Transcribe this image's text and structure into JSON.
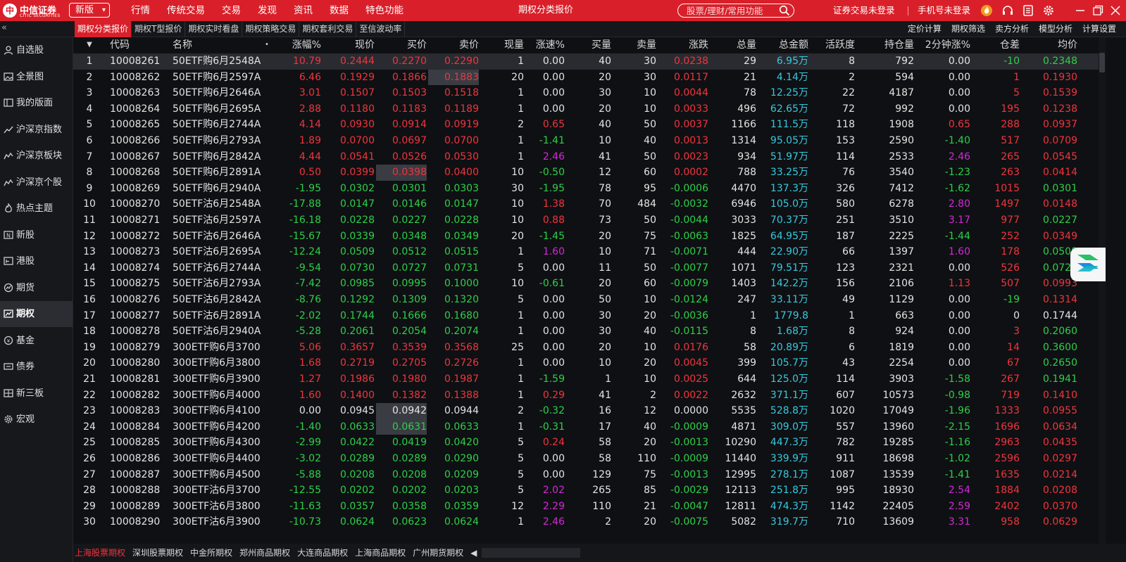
{
  "topbar": {
    "logo_cn": "中信证券",
    "logo_en": "CITIC SECURITIES",
    "version_label": "新版",
    "menu": [
      "行情",
      "传统交易",
      "交易",
      "发现",
      "资讯",
      "数据",
      "特色功能"
    ],
    "window_title": "期权分类报价",
    "search_placeholder": "股票/理财/常用功能",
    "trade_login": "证券交易未登录",
    "phone_login": "手机号未登录"
  },
  "subtabs": [
    "期权分类报价",
    "期权T型报价",
    "期权实时看盘",
    "期权策略交易",
    "期权套利交易",
    "至信波动率"
  ],
  "tools": [
    "定价计算",
    "期权筛选",
    "卖方分析",
    "模型分析",
    "计算设置"
  ],
  "sidebar": {
    "items": [
      {
        "label": "自选股",
        "icon": "user-icon"
      },
      {
        "label": "全景图",
        "icon": "image-icon"
      },
      {
        "label": "我的版面",
        "icon": "layout-icon"
      },
      {
        "label": "沪深京指数",
        "icon": "line-chart-icon"
      },
      {
        "label": "沪深京板块",
        "icon": "trend-icon"
      },
      {
        "label": "沪深京个股",
        "icon": "trend-icon"
      },
      {
        "label": "热点主题",
        "icon": "flame-icon"
      },
      {
        "label": "新股",
        "icon": "new-icon"
      },
      {
        "label": "港股",
        "icon": "hk-icon"
      },
      {
        "label": "期货",
        "icon": "gauge-icon"
      },
      {
        "label": "期权",
        "icon": "option-chart-icon"
      },
      {
        "label": "基金",
        "icon": "yen-icon"
      },
      {
        "label": "债券",
        "icon": "ticket-icon"
      },
      {
        "label": "新三板",
        "icon": "board-icon"
      },
      {
        "label": "宏观",
        "icon": "gear-icon"
      }
    ],
    "active_index": 10
  },
  "table": {
    "sort_mark": "▼",
    "name_mark": "•",
    "columns": [
      "",
      "代码",
      "名称",
      "涨幅%",
      "现价",
      "买价",
      "卖价",
      "现量",
      "涨速%",
      "买量",
      "卖量",
      "涨跌",
      "总量",
      "总金额",
      "活跃度",
      "持仓量",
      "2分钟涨%",
      "仓差",
      "均价"
    ],
    "rows": [
      [
        "1",
        "10008261",
        "50ETF购6月2548A",
        "10.79",
        "0.2444",
        "0.2270",
        "0.2290",
        "1",
        "0.00",
        "40",
        "30",
        "0.0238",
        "29",
        "6.95万",
        "8",
        "792",
        "0.00",
        "-10",
        "0.2348"
      ],
      [
        "2",
        "10008262",
        "50ETF购6月2597A",
        "6.46",
        "0.1929",
        "0.1866",
        "0.1883",
        "20",
        "0.00",
        "20",
        "30",
        "0.0117",
        "21",
        "4.14万",
        "2",
        "594",
        "0.00",
        "1",
        "0.1930"
      ],
      [
        "3",
        "10008263",
        "50ETF购6月2646A",
        "3.01",
        "0.1507",
        "0.1503",
        "0.1518",
        "1",
        "0.00",
        "30",
        "10",
        "0.0044",
        "78",
        "12.25万",
        "22",
        "4187",
        "0.00",
        "5",
        "0.1539"
      ],
      [
        "4",
        "10008264",
        "50ETF购6月2695A",
        "2.88",
        "0.1180",
        "0.1183",
        "0.1189",
        "1",
        "0.00",
        "20",
        "10",
        "0.0033",
        "496",
        "62.65万",
        "72",
        "992",
        "0.00",
        "195",
        "0.1238"
      ],
      [
        "5",
        "10008265",
        "50ETF购6月2744A",
        "4.14",
        "0.0930",
        "0.0914",
        "0.0919",
        "2",
        "0.65",
        "40",
        "50",
        "0.0037",
        "1166",
        "111.5万",
        "118",
        "1908",
        "0.65",
        "288",
        "0.0937"
      ],
      [
        "6",
        "10008266",
        "50ETF购6月2793A",
        "1.89",
        "0.0700",
        "0.0697",
        "0.0700",
        "1",
        "-1.41",
        "10",
        "40",
        "0.0013",
        "1314",
        "95.05万",
        "153",
        "2590",
        "-1.40",
        "517",
        "0.0709"
      ],
      [
        "7",
        "10008267",
        "50ETF购6月2842A",
        "4.44",
        "0.0541",
        "0.0526",
        "0.0530",
        "1",
        "2.46",
        "41",
        "50",
        "0.0023",
        "934",
        "51.97万",
        "114",
        "2533",
        "2.46",
        "265",
        "0.0545"
      ],
      [
        "8",
        "10008268",
        "50ETF购6月2891A",
        "0.50",
        "0.0399",
        "0.0398",
        "0.0400",
        "10",
        "-0.50",
        "12",
        "60",
        "0.0002",
        "788",
        "33.25万",
        "76",
        "3540",
        "-1.23",
        "263",
        "0.0414"
      ],
      [
        "9",
        "10008269",
        "50ETF购6月2940A",
        "-1.95",
        "0.0302",
        "0.0301",
        "0.0303",
        "30",
        "-1.95",
        "78",
        "95",
        "-0.0006",
        "4470",
        "137.3万",
        "326",
        "7412",
        "-1.62",
        "1015",
        "0.0301"
      ],
      [
        "10",
        "10008270",
        "50ETF沽6月2548A",
        "-17.88",
        "0.0147",
        "0.0146",
        "0.0147",
        "10",
        "1.38",
        "70",
        "484",
        "-0.0032",
        "6946",
        "105.0万",
        "580",
        "6278",
        "2.80",
        "1497",
        "0.0148"
      ],
      [
        "11",
        "10008271",
        "50ETF沽6月2597A",
        "-16.18",
        "0.0228",
        "0.0227",
        "0.0228",
        "10",
        "0.88",
        "73",
        "50",
        "-0.0044",
        "3033",
        "70.37万",
        "251",
        "3510",
        "3.17",
        "977",
        "0.0227"
      ],
      [
        "12",
        "10008272",
        "50ETF沽6月2646A",
        "-15.67",
        "0.0339",
        "0.0348",
        "0.0349",
        "20",
        "-1.45",
        "20",
        "75",
        "-0.0063",
        "1825",
        "64.95万",
        "187",
        "2225",
        "-1.44",
        "252",
        "0.0349"
      ],
      [
        "13",
        "10008273",
        "50ETF沽6月2695A",
        "-12.24",
        "0.0509",
        "0.0512",
        "0.0515",
        "1",
        "1.60",
        "10",
        "71",
        "-0.0071",
        "444",
        "22.90万",
        "66",
        "1397",
        "1.60",
        "178",
        "0.0508"
      ],
      [
        "14",
        "10008274",
        "50ETF沽6月2744A",
        "-9.54",
        "0.0730",
        "0.0727",
        "0.0731",
        "5",
        "0.00",
        "11",
        "50",
        "-0.0077",
        "1071",
        "79.51万",
        "123",
        "2321",
        "0.00",
        "526",
        "0.0728"
      ],
      [
        "15",
        "10008275",
        "50ETF沽6月2793A",
        "-7.42",
        "0.0985",
        "0.0995",
        "0.1000",
        "10",
        "-0.61",
        "20",
        "60",
        "-0.0079",
        "1403",
        "142.2万",
        "156",
        "2106",
        "1.13",
        "507",
        "0.0993"
      ],
      [
        "16",
        "10008276",
        "50ETF沽6月2842A",
        "-8.76",
        "0.1292",
        "0.1309",
        "0.1320",
        "5",
        "0.00",
        "50",
        "10",
        "-0.0124",
        "247",
        "33.11万",
        "49",
        "1129",
        "0.00",
        "-19",
        "0.1314"
      ],
      [
        "17",
        "10008277",
        "50ETF沽6月2891A",
        "-2.02",
        "0.1744",
        "0.1666",
        "0.1680",
        "1",
        "0.00",
        "30",
        "20",
        "-0.0036",
        "1",
        "1779.8",
        "1",
        "663",
        "0.00",
        "0",
        "0.1744"
      ],
      [
        "18",
        "10008278",
        "50ETF沽6月2940A",
        "-5.28",
        "0.2061",
        "0.2054",
        "0.2074",
        "1",
        "0.00",
        "30",
        "40",
        "-0.0115",
        "8",
        "1.68万",
        "8",
        "924",
        "0.00",
        "3",
        "0.2060"
      ],
      [
        "19",
        "10008279",
        "300ETF购6月3700",
        "5.06",
        "0.3657",
        "0.3539",
        "0.3568",
        "25",
        "0.00",
        "20",
        "10",
        "0.0176",
        "58",
        "20.89万",
        "6",
        "1819",
        "0.00",
        "14",
        "0.3600"
      ],
      [
        "20",
        "10008280",
        "300ETF购6月3800",
        "1.68",
        "0.2719",
        "0.2705",
        "0.2726",
        "1",
        "0.00",
        "10",
        "20",
        "0.0045",
        "399",
        "105.7万",
        "43",
        "2254",
        "0.00",
        "67",
        "0.2650"
      ],
      [
        "21",
        "10008281",
        "300ETF购6月3900",
        "1.27",
        "0.1986",
        "0.1980",
        "0.1987",
        "1",
        "-1.59",
        "1",
        "10",
        "0.0025",
        "644",
        "125.0万",
        "114",
        "3903",
        "-1.58",
        "267",
        "0.1941"
      ],
      [
        "22",
        "10008282",
        "300ETF购6月4000",
        "1.60",
        "0.1400",
        "0.1382",
        "0.1388",
        "1",
        "0.29",
        "41",
        "2",
        "0.0022",
        "2632",
        "371.1万",
        "607",
        "10573",
        "-0.98",
        "719",
        "0.1410"
      ],
      [
        "23",
        "10008283",
        "300ETF购6月4100",
        "0.00",
        "0.0945",
        "0.0942",
        "0.0944",
        "2",
        "-0.32",
        "16",
        "12",
        "0.0000",
        "5535",
        "528.8万",
        "1020",
        "17049",
        "-1.96",
        "1333",
        "0.0955"
      ],
      [
        "24",
        "10008284",
        "300ETF购6月4200",
        "-1.40",
        "0.0633",
        "0.0631",
        "0.0633",
        "1",
        "-0.31",
        "17",
        "40",
        "-0.0009",
        "4871",
        "309.0万",
        "557",
        "13960",
        "-2.15",
        "1696",
        "0.0634"
      ],
      [
        "25",
        "10008285",
        "300ETF购6月4300",
        "-2.99",
        "0.0422",
        "0.0419",
        "0.0420",
        "5",
        "0.24",
        "58",
        "20",
        "-0.0013",
        "10290",
        "447.3万",
        "782",
        "19285",
        "-1.16",
        "2963",
        "0.0435"
      ],
      [
        "26",
        "10008286",
        "300ETF购6月4400",
        "-3.02",
        "0.0289",
        "0.0289",
        "0.0290",
        "5",
        "0.00",
        "58",
        "110",
        "-0.0009",
        "11440",
        "339.9万",
        "911",
        "18698",
        "-1.02",
        "2596",
        "0.0297"
      ],
      [
        "27",
        "10008287",
        "300ETF购6月4500",
        "-5.88",
        "0.0208",
        "0.0208",
        "0.0209",
        "5",
        "0.00",
        "129",
        "75",
        "-0.0013",
        "12995",
        "278.1万",
        "1087",
        "13539",
        "-1.41",
        "1635",
        "0.0214"
      ],
      [
        "28",
        "10008288",
        "300ETF沽6月3700",
        "-12.55",
        "0.0202",
        "0.0202",
        "0.0203",
        "5",
        "2.02",
        "265",
        "85",
        "-0.0029",
        "12113",
        "251.8万",
        "995",
        "18930",
        "2.54",
        "1884",
        "0.0208"
      ],
      [
        "29",
        "10008289",
        "300ETF沽6月3800",
        "-11.63",
        "0.0357",
        "0.0358",
        "0.0359",
        "12",
        "2.29",
        "110",
        "21",
        "-0.0047",
        "12811",
        "474.3万",
        "1142",
        "22405",
        "2.59",
        "2402",
        "0.0370"
      ],
      [
        "30",
        "10008290",
        "300ETF沽6月3900",
        "-10.73",
        "0.0624",
        "0.0623",
        "0.0624",
        "1",
        "2.46",
        "2",
        "20",
        "-0.0075",
        "5082",
        "319.7万",
        "710",
        "13609",
        "3.31",
        "958",
        "0.0629"
      ]
    ]
  },
  "bottom_tabs": [
    "上海股票期权",
    "深圳股票期权",
    "中金所期权",
    "郑州商品期权",
    "大连商品期权",
    "上海商品期权",
    "广州期货期权"
  ],
  "bottom_nav": "◀",
  "colors": {
    "up": "#f0353d",
    "down": "#2dd04a",
    "amount": "#36c9e0",
    "speed_up": "#d02ad6",
    "brand": "#d9202a"
  }
}
